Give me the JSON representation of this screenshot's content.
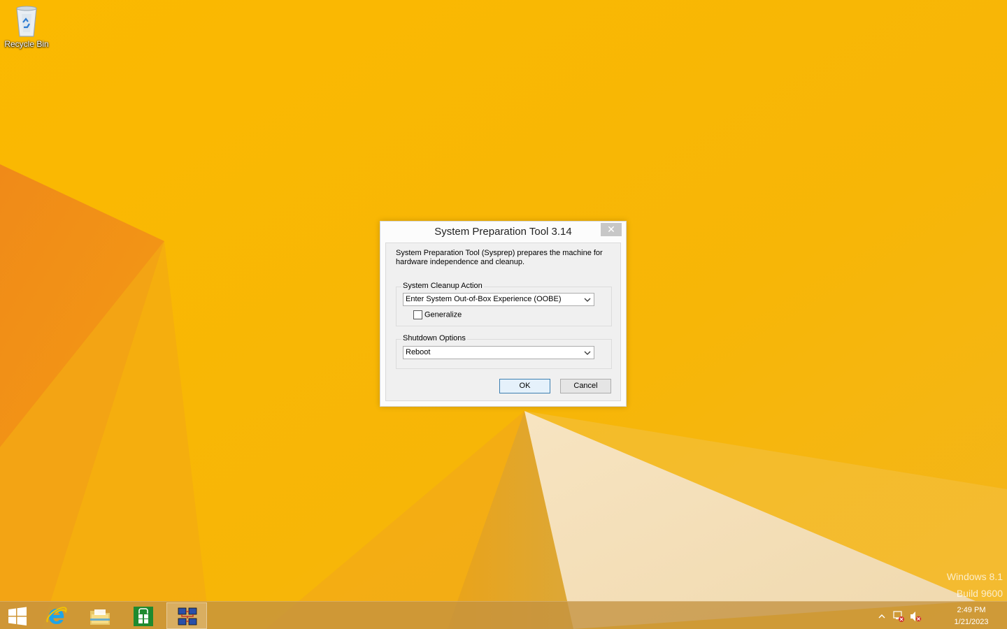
{
  "desktop": {
    "icons": [
      {
        "label": "Recycle Bin"
      }
    ]
  },
  "dialog": {
    "title": "System Preparation Tool 3.14",
    "close_glyph": "✕",
    "description": "System Preparation Tool (Sysprep) prepares the machine for hardware independence and cleanup.",
    "cleanup_group": {
      "label": "System Cleanup Action",
      "selected": "Enter System Out-of-Box Experience (OOBE)",
      "generalize_label": "Generalize",
      "generalize_checked": false
    },
    "shutdown_group": {
      "label": "Shutdown Options",
      "selected": "Reboot"
    },
    "ok_label": "OK",
    "cancel_label": "Cancel"
  },
  "watermark": {
    "line1": "Windows 8.1",
    "line2": "Build 9600"
  },
  "taskbar": {
    "pinned": [
      {
        "name": "start",
        "icon": "windows-logo-icon"
      },
      {
        "name": "internet-explorer",
        "icon": "internet-explorer-icon"
      },
      {
        "name": "file-explorer",
        "icon": "folder-icon"
      },
      {
        "name": "store",
        "icon": "store-icon"
      },
      {
        "name": "sysprep",
        "icon": "sysprep-icon",
        "active": true
      }
    ],
    "clock": {
      "time": "2:49 PM",
      "date": "1/21/2023"
    }
  },
  "colors": {
    "wallpaper_base": "#f5b400",
    "wallpaper_orange": "#f07b12",
    "wallpaper_light": "#f6e7c9",
    "accent_blue": "#3c7fb1"
  }
}
